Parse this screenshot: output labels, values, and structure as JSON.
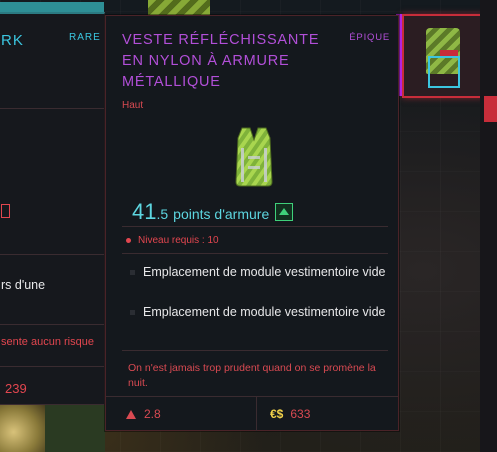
{
  "left_card": {
    "title": "RK",
    "rarity": "RARE",
    "partial_text": "rs d'une",
    "partial_warning": "sente aucun risque",
    "price": "239"
  },
  "tooltip": {
    "name": "VESTE RÉFLÉCHISSANTE EN NYLON À ARMURE MÉTALLIQUE",
    "rarity": "ÉPIQUE",
    "type": "Haut",
    "armor_value_int": "41",
    "armor_value_dec": ".5",
    "armor_label": "points d'armure",
    "level_required": "Niveau requis : 10",
    "slots": [
      "Emplacement de module vestimentoire vide",
      "Emplacement de module vestimentoire vide"
    ],
    "quote": "On n'est jamais trop prudent quand on se promène la nuit.",
    "weight": "2.8",
    "currency_symbol": "€$",
    "price": "633"
  },
  "colors": {
    "epic": "#b24fd8",
    "rare": "#3bc6e0",
    "armor": "#5dd6e0",
    "warning": "#e2464f",
    "upgrade": "#3fd07a",
    "currency": "#f2d24a"
  },
  "icons": {
    "upgrade": "arrow-up-icon",
    "weight": "weight-icon",
    "level": "dot-icon",
    "currency": "eurodollar-icon"
  }
}
